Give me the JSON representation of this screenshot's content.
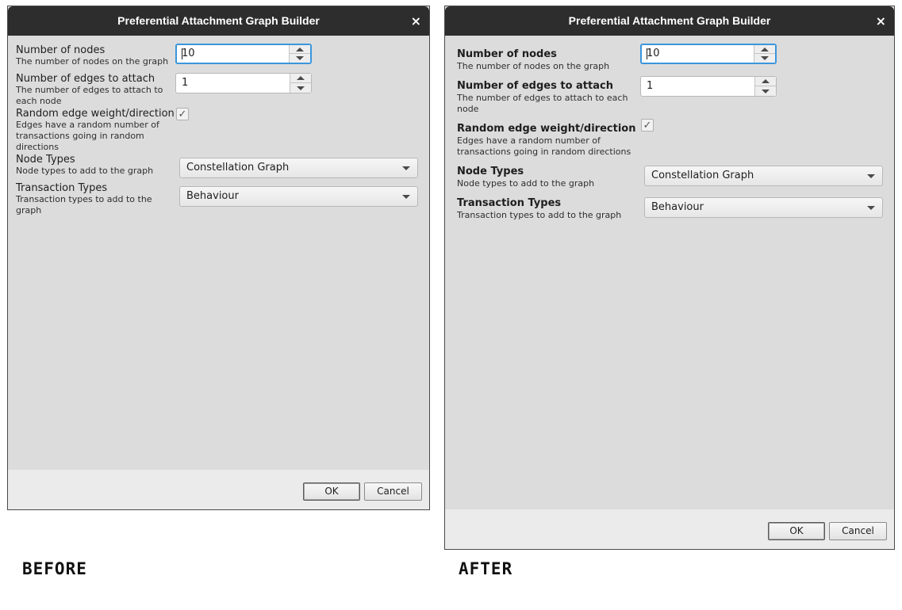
{
  "before": {
    "title": "Preferential Attachment Graph Builder",
    "close_icon": "×",
    "nodes": {
      "label": "Number of nodes",
      "desc": "The number of nodes on the graph",
      "value": "10"
    },
    "edges": {
      "label": "Number of edges to attach",
      "desc": "The number of edges to attach to each node",
      "value": "1"
    },
    "random": {
      "label": "Random edge weight/direction",
      "desc": "Edges have a random number of transactions going in random directions",
      "checked": true,
      "check_glyph": "✓"
    },
    "node_types": {
      "label": "Node Types",
      "desc": "Node types to add to the graph",
      "value": "Constellation Graph"
    },
    "transaction_types": {
      "label": "Transaction Types",
      "desc": "Transaction types to add to the graph",
      "value": "Behaviour"
    },
    "ok_label": "OK",
    "cancel_label": "Cancel"
  },
  "after": {
    "title": "Preferential Attachment Graph Builder",
    "close_icon": "×",
    "nodes": {
      "label": "Number of nodes",
      "desc": "The number of nodes on the graph",
      "value": "10"
    },
    "edges": {
      "label": "Number of edges to attach",
      "desc": "The number of edges to attach to each node",
      "value": "1"
    },
    "random": {
      "label": "Random edge weight/direction",
      "desc": "Edges have a random number of transactions going in random directions",
      "checked": true,
      "check_glyph": "✓"
    },
    "node_types": {
      "label": "Node Types",
      "desc": "Node types to add to the graph",
      "value": "Constellation Graph"
    },
    "transaction_types": {
      "label": "Transaction Types",
      "desc": "Transaction types to add to the graph",
      "value": "Behaviour"
    },
    "ok_label": "OK",
    "cancel_label": "Cancel"
  },
  "captions": {
    "before": "BEFORE",
    "after": "AFTER"
  },
  "colors": {
    "titlebar": "#2d2d2d",
    "focus": "#3a96dd",
    "panel": "#dcdcdc"
  }
}
